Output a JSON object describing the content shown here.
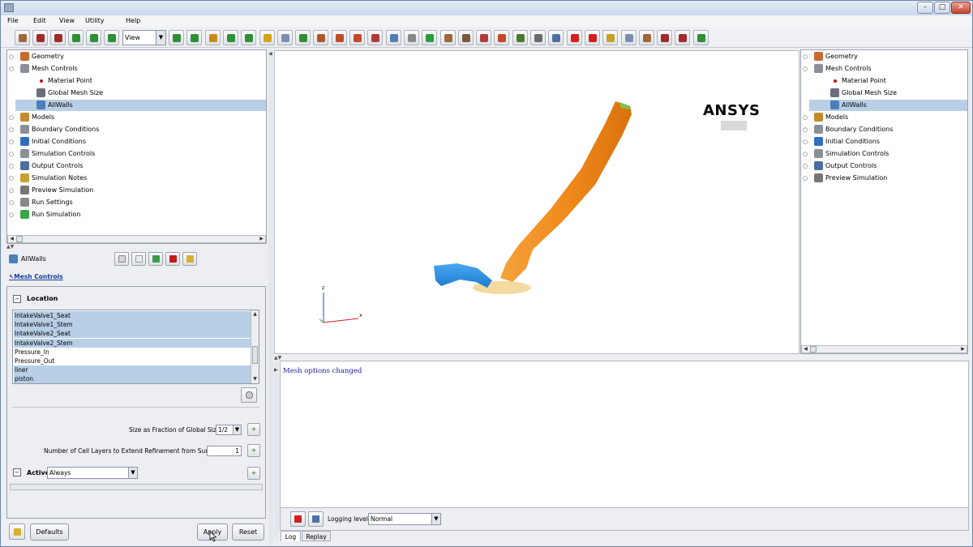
{
  "window": {
    "title": ""
  },
  "menu": [
    "File",
    "Edit",
    "View",
    "Utility",
    "Help"
  ],
  "toolbar": {
    "view_combo": "View",
    "icon_colors": [
      "#a0673a",
      "#a32a2a",
      "#a32a2a",
      "#2f8f35",
      "#2f8f35",
      "#2f8f35",
      "#2f8f35",
      "#2f8f35",
      "#c98a1e",
      "#2f8f35",
      "#2f8f35",
      "#d6a21c",
      "#7a8fb0",
      "#2f8f35",
      "#ad5a28",
      "#c24a2a",
      "#c24a2a",
      "#b13a3a",
      "#4f7fb5",
      "#888",
      "#2a9d3a",
      "#9b6a3a",
      "#7a5a3a",
      "#b23a3a",
      "#c24a2a",
      "#4d7a2a",
      "#6b6b6b",
      "#4f6fa5",
      "#d41f1f",
      "#d41f1f",
      "#c8a028",
      "#7a8fb0"
    ]
  },
  "left_tree": {
    "items": [
      {
        "label": "Geometry",
        "level": 0,
        "icon": "geometry-icon",
        "color": "#c76b2e"
      },
      {
        "label": "Mesh Controls",
        "level": 0,
        "icon": "mesh-controls-icon",
        "color": "#8a8f98"
      },
      {
        "label": "Material Point",
        "level": 1,
        "icon": "material-point-icon",
        "color": "#b11"
      },
      {
        "label": "Global Mesh Size",
        "level": 1,
        "icon": "global-mesh-size-icon",
        "color": "#6a6f7a"
      },
      {
        "label": "AllWalls",
        "level": 1,
        "icon": "allwalls-icon",
        "color": "#4a7fb8",
        "selected": true
      },
      {
        "label": "Models",
        "level": 0,
        "icon": "models-icon",
        "color": "#c38a2a"
      },
      {
        "label": "Boundary Conditions",
        "level": 0,
        "icon": "boundary-conditions-icon",
        "color": "#8a8f98"
      },
      {
        "label": "Initial Conditions",
        "level": 0,
        "icon": "initial-conditions-icon",
        "color": "#2e6fc0"
      },
      {
        "label": "Simulation Controls",
        "level": 0,
        "icon": "simulation-controls-icon",
        "color": "#8a8f98"
      },
      {
        "label": "Output Controls",
        "level": 0,
        "icon": "output-controls-icon",
        "color": "#4a6fa0"
      },
      {
        "label": "Simulation Notes",
        "level": 0,
        "icon": "simulation-notes-icon",
        "color": "#c8a030"
      },
      {
        "label": "Preview Simulation",
        "level": 0,
        "icon": "preview-simulation-icon",
        "color": "#777"
      },
      {
        "label": "Run Settings",
        "level": 0,
        "icon": "run-settings-icon",
        "color": "#888"
      },
      {
        "label": "Run Simulation",
        "level": 0,
        "icon": "run-simulation-icon",
        "color": "#3aa845"
      }
    ]
  },
  "right_tree": {
    "items": [
      {
        "label": "Geometry",
        "level": 0,
        "color": "#c76b2e"
      },
      {
        "label": "Mesh Controls",
        "level": 0,
        "color": "#8a8f98"
      },
      {
        "label": "Material Point",
        "level": 1,
        "color": "#b11"
      },
      {
        "label": "Global Mesh Size",
        "level": 1,
        "color": "#6a6f7a"
      },
      {
        "label": "AllWalls",
        "level": 1,
        "color": "#4a7fb8",
        "selected": true
      },
      {
        "label": "Models",
        "level": 0,
        "color": "#c38a2a"
      },
      {
        "label": "Boundary Conditions",
        "level": 0,
        "color": "#8a8f98"
      },
      {
        "label": "Initial Conditions",
        "level": 0,
        "color": "#2e6fc0"
      },
      {
        "label": "Simulation Controls",
        "level": 0,
        "color": "#8a8f98"
      },
      {
        "label": "Output Controls",
        "level": 0,
        "color": "#4a6fa0"
      },
      {
        "label": "Preview Simulation",
        "level": 0,
        "color": "#777"
      }
    ]
  },
  "props": {
    "title": "AllWalls",
    "breadcrumb": "↖Mesh Controls",
    "location_label": "Location",
    "locations": [
      {
        "label": "IntakeValve1_Seat",
        "selected": true
      },
      {
        "label": "IntakeValve1_Stem",
        "selected": true
      },
      {
        "label": "IntakeValve2_Seat",
        "selected": true
      },
      {
        "label": "IntakeValve2_Stem",
        "selected": true
      },
      {
        "label": "Pressure_In",
        "selected": false
      },
      {
        "label": "Pressure_Out",
        "selected": false
      },
      {
        "label": "liner",
        "selected": true
      },
      {
        "label": "piston",
        "selected": true
      }
    ],
    "size_fraction_label": "Size as Fraction of Global Size",
    "size_fraction_value": "1/2",
    "cell_layers_label": "Number of Cell Layers to Extend Refinement from Surface",
    "cell_layers_value": "1",
    "active_label": "Active",
    "active_value": "Always",
    "defaults_button": "Defaults",
    "apply_button": "Apply",
    "reset_button": "Reset"
  },
  "viewport": {
    "logo": "ANSYS",
    "axis_z": "z",
    "axis_x": "x"
  },
  "log": {
    "message": "Mesh options changed",
    "logging_level_label": "Logging level:",
    "logging_level_value": "Normal",
    "tabs": [
      "Log",
      "Replay"
    ]
  },
  "colors": {
    "selection": "#b8cfe6",
    "geometry_orange": "#f28a1e",
    "geometry_blue": "#2a8fe0"
  }
}
